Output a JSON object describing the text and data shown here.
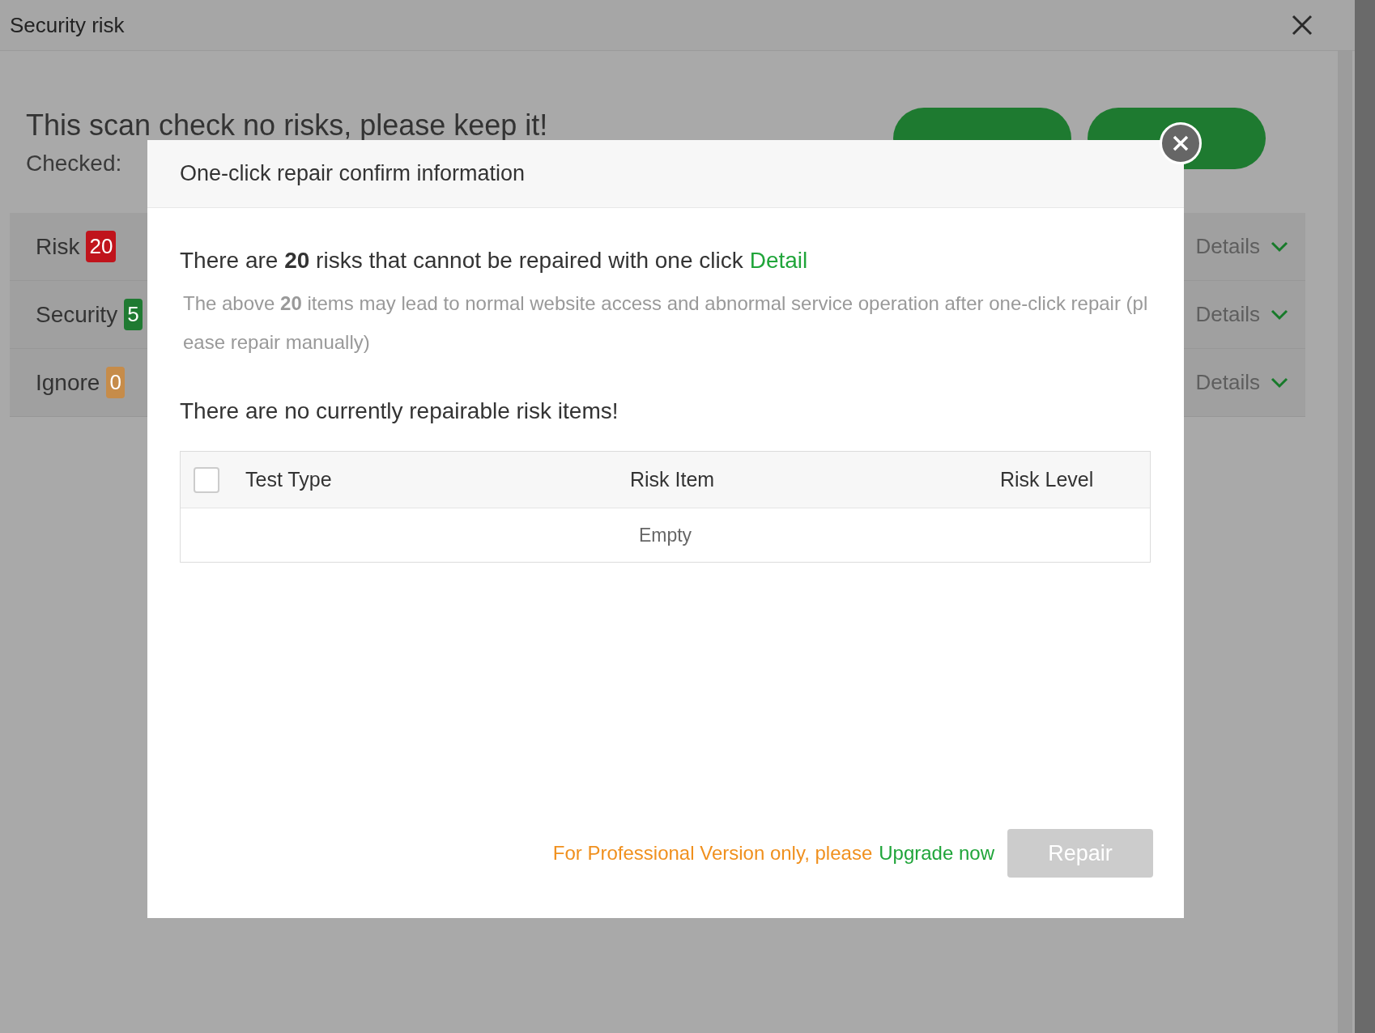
{
  "window": {
    "title": "Security risk"
  },
  "summary": {
    "headline": "This scan check no risks, please keep it!",
    "checked": "Checked:"
  },
  "categories": [
    {
      "label": "Risk",
      "count": "20",
      "color": "#c0141c",
      "details": "Details"
    },
    {
      "label": "Security",
      "count": "5",
      "color": "#1f7a32",
      "details": "Details"
    },
    {
      "label": "Ignore",
      "count": "0",
      "color": "#c68c4a",
      "details": "Details"
    }
  ],
  "dialog": {
    "title": "One-click repair confirm information",
    "notice": "There are **20** risks that cannot be repaired with one click",
    "notice_link": "Detail",
    "note": "The above **20** items may lead to normal website access and abnormal service operation after one-click repair (please repair manually)",
    "status": "There are no currently repairable risk items!",
    "table": {
      "select_all": {
        "checked": false
      },
      "columns": [
        "Test Type",
        "Risk Item",
        "Risk Level"
      ],
      "empty": "Empty"
    },
    "footer_text": "For Professional Version only, please",
    "footer_link": "Upgrade now",
    "repair": {
      "label": "Repair",
      "disabled": true
    }
  }
}
